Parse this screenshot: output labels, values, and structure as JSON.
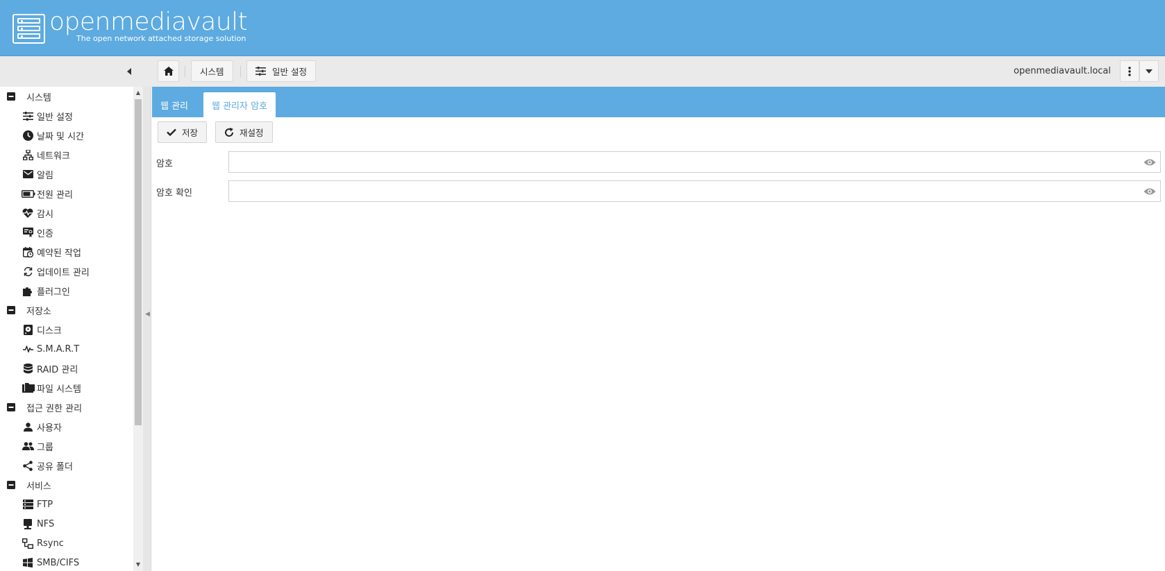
{
  "header": {
    "logo_text": "openmediavault",
    "logo_subtitle": "The open network attached storage solution",
    "brand_color": "#5dabe0"
  },
  "toolbar": {
    "collapse_icon": "caret-left-icon",
    "breadcrumbs": [
      {
        "icon": "home-icon",
        "label": ""
      },
      {
        "icon": "",
        "label": "시스템"
      },
      {
        "icon": "sliders-icon",
        "label": "일반 설정"
      }
    ],
    "hostname": "openmediavault.local",
    "menu_icon": "kebab-menu-icon",
    "dropdown_icon": "caret-down-icon"
  },
  "sidebar": {
    "groups": [
      {
        "label": "시스템",
        "icon": "minus-square-icon",
        "items": [
          {
            "label": "일반 설정",
            "icon": "sliders-icon"
          },
          {
            "label": "날짜 및 시간",
            "icon": "clock-icon"
          },
          {
            "label": "네트워크",
            "icon": "network-icon"
          },
          {
            "label": "알림",
            "icon": "mail-icon"
          },
          {
            "label": "전원 관리",
            "icon": "battery-icon"
          },
          {
            "label": "감시",
            "icon": "heart-pulse-icon"
          },
          {
            "label": "인증",
            "icon": "certificate-icon"
          },
          {
            "label": "예약된 작업",
            "icon": "calendar-clock-icon"
          },
          {
            "label": "업데이트 관리",
            "icon": "refresh-icon"
          },
          {
            "label": "플러그인",
            "icon": "puzzle-icon"
          }
        ]
      },
      {
        "label": "저장소",
        "icon": "minus-square-icon",
        "items": [
          {
            "label": "디스크",
            "icon": "harddisk-icon"
          },
          {
            "label": "S.M.A.R.T",
            "icon": "pulse-icon"
          },
          {
            "label": "RAID 관리",
            "icon": "database-icon"
          },
          {
            "label": "파일 시스템",
            "icon": "folders-icon"
          }
        ]
      },
      {
        "label": "접근 권한 관리",
        "icon": "minus-square-icon",
        "items": [
          {
            "label": "사용자",
            "icon": "user-icon"
          },
          {
            "label": "그룹",
            "icon": "users-icon"
          },
          {
            "label": "공유 폴더",
            "icon": "share-icon"
          }
        ]
      },
      {
        "label": "서비스",
        "icon": "minus-square-icon",
        "items": [
          {
            "label": "FTP",
            "icon": "server-icon"
          },
          {
            "label": "NFS",
            "icon": "monitor-icon"
          },
          {
            "label": "Rsync",
            "icon": "sync-network-icon"
          },
          {
            "label": "SMB/CIFS",
            "icon": "windows-icon"
          }
        ]
      }
    ]
  },
  "main": {
    "tabs": [
      {
        "label": "웹 관리",
        "active": false
      },
      {
        "label": "웹 관리자 암호",
        "active": true
      }
    ],
    "buttons": {
      "save_label": "저장",
      "reset_label": "재설정"
    },
    "fields": [
      {
        "label": "암호",
        "value": "",
        "placeholder": ""
      },
      {
        "label": "암호 확인",
        "value": "",
        "placeholder": ""
      }
    ]
  }
}
